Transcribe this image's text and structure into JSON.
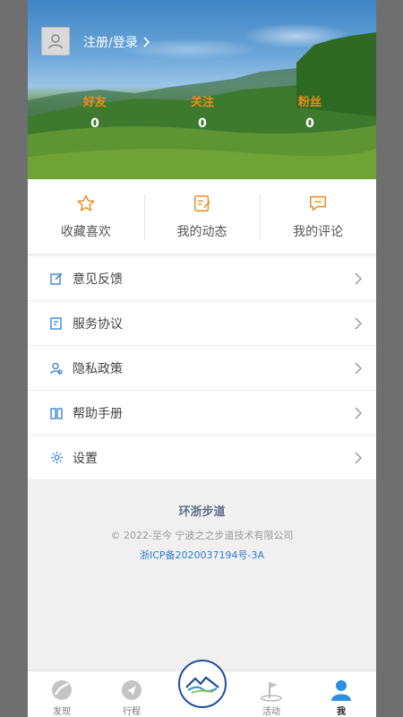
{
  "header": {
    "login_text": "注册/登录",
    "stats": [
      {
        "label": "好友",
        "value": "0"
      },
      {
        "label": "关注",
        "value": "0"
      },
      {
        "label": "粉丝",
        "value": "0"
      }
    ]
  },
  "quick_actions": [
    {
      "label": "收藏喜欢",
      "icon": "star-icon"
    },
    {
      "label": "我的动态",
      "icon": "post-icon"
    },
    {
      "label": "我的评论",
      "icon": "comment-icon"
    }
  ],
  "menu": [
    {
      "label": "意见反馈",
      "icon": "feedback-icon"
    },
    {
      "label": "服务协议",
      "icon": "agreement-icon"
    },
    {
      "label": "隐私政策",
      "icon": "privacy-icon"
    },
    {
      "label": "帮助手册",
      "icon": "help-manual-icon"
    },
    {
      "label": "设置",
      "icon": "gear-icon"
    }
  ],
  "footer": {
    "name": "环浙步道",
    "copyright": "© 2022-至今 宁波之之步道技术有限公司",
    "icp": "浙ICP备2020037194号-3A"
  },
  "tabbar": {
    "tabs": [
      {
        "label": "发现",
        "icon": "discover-icon"
      },
      {
        "label": "行程",
        "icon": "trip-icon"
      },
      {
        "label": "活动",
        "icon": "activity-flag-icon"
      },
      {
        "label": "我",
        "icon": "profile-icon"
      }
    ],
    "active": "我"
  },
  "colors": {
    "accent_orange": "#f08a1c",
    "accent_blue": "#2d7dd2",
    "brand_navy": "#1f4e9c"
  }
}
